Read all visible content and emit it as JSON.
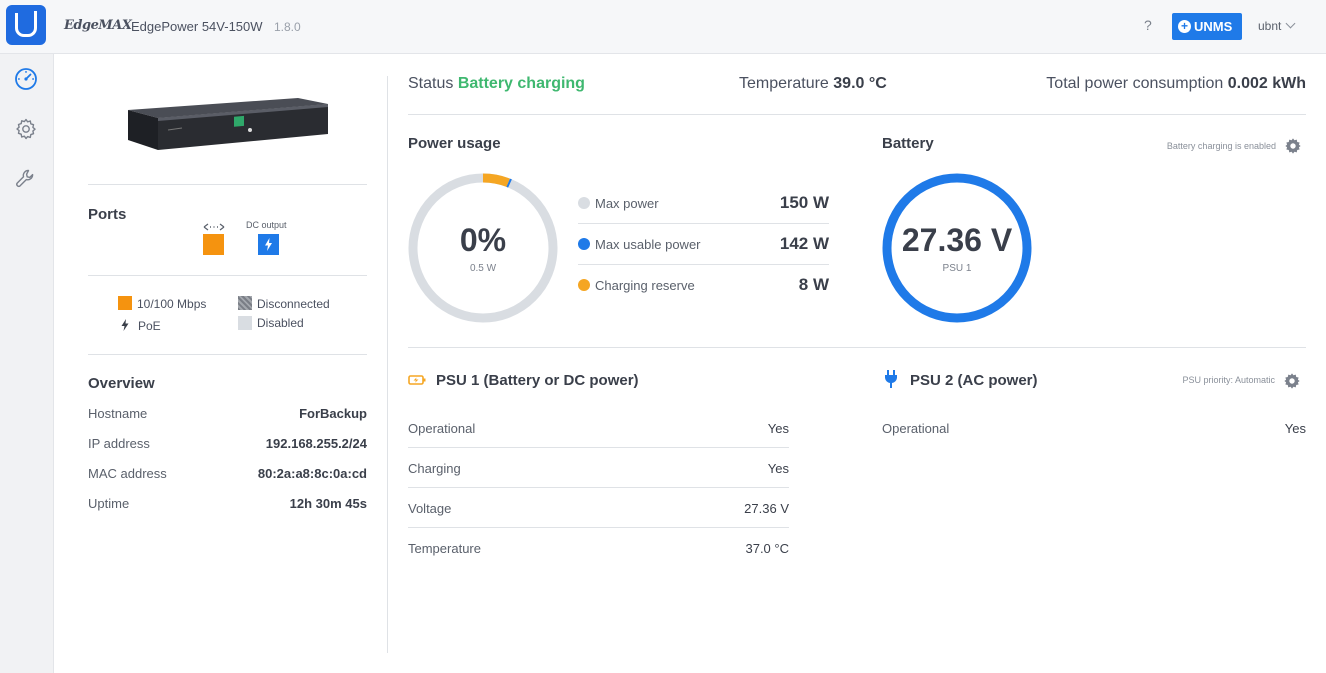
{
  "header": {
    "brand": "EdgeMAX",
    "product": "EdgePower 54V-150W",
    "version": "1.8.0",
    "help": "?",
    "unms_label": "UNMS",
    "user": "ubnt"
  },
  "sidebar": {
    "items": [
      {
        "icon": "dashboard-icon"
      },
      {
        "icon": "gear-icon"
      },
      {
        "icon": "wrench-icon"
      }
    ]
  },
  "ports": {
    "title": "Ports",
    "dc_output_label": "DC output",
    "port_color": "#f5930f",
    "dc_color": "#1f7ae8"
  },
  "legend": {
    "speed": "10/100 Mbps",
    "poe": "PoE",
    "disconnected": "Disconnected",
    "disabled": "Disabled"
  },
  "overview": {
    "title": "Overview",
    "rows": [
      {
        "label": "Hostname",
        "value": "ForBackup"
      },
      {
        "label": "IP address",
        "value": "192.168.255.2/24"
      },
      {
        "label": "MAC address",
        "value": "80:2a:a8:8c:0a:cd"
      },
      {
        "label": "Uptime",
        "value": "12h 30m 45s"
      }
    ]
  },
  "status": {
    "status_label": "Status",
    "status_value": "Battery charging",
    "temp_label": "Temperature",
    "temp_value": "39.0 °C",
    "consumption_label": "Total power consumption",
    "consumption_value": "0.002 kWh"
  },
  "power_usage": {
    "title": "Power usage",
    "percent": "0%",
    "watts": "0.5 W",
    "rows": [
      {
        "label": "Max power",
        "value": "150 W",
        "color": "#d9dde2"
      },
      {
        "label": "Max usable power",
        "value": "142 W",
        "color": "#1f7ae8"
      },
      {
        "label": "Charging reserve",
        "value": "8 W",
        "color": "#f5a623"
      }
    ]
  },
  "battery": {
    "title": "Battery",
    "hint": "Battery charging is enabled",
    "voltage": "27.36 V",
    "source": "PSU 1",
    "ring_color": "#1f7ae8"
  },
  "psu1": {
    "title": "PSU 1 (Battery or DC power)",
    "rows": [
      {
        "label": "Operational",
        "value": "Yes"
      },
      {
        "label": "Charging",
        "value": "Yes"
      },
      {
        "label": "Voltage",
        "value": "27.36 V"
      },
      {
        "label": "Temperature",
        "value": "37.0 °C"
      }
    ]
  },
  "psu2": {
    "title": "PSU 2 (AC power)",
    "hint": "PSU priority: Automatic",
    "rows": [
      {
        "label": "Operational",
        "value": "Yes"
      }
    ]
  }
}
